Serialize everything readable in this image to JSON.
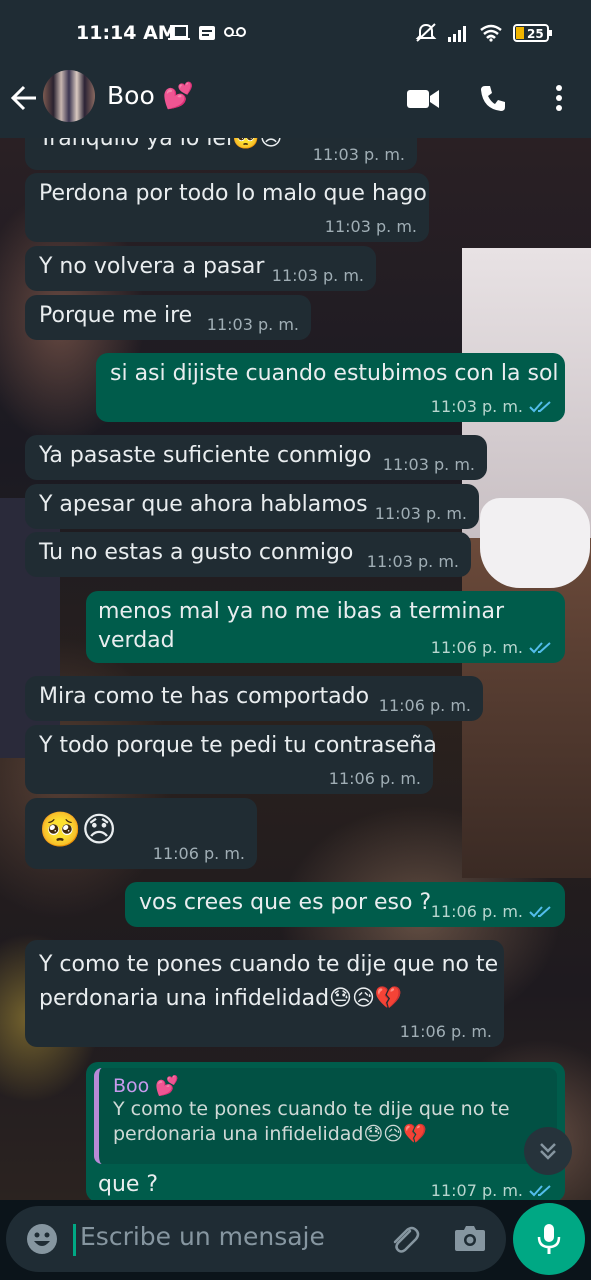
{
  "status_bar": {
    "time": "11:14 AM",
    "battery": "25"
  },
  "header": {
    "contact_name": "Boo 💕"
  },
  "messages": [
    {
      "text": "Tranquilo ya lo leí🥺😞",
      "time": "11:03 p. m."
    },
    {
      "text": "Perdona por todo lo malo que hago",
      "time": "11:03 p. m."
    },
    {
      "text": "Y no volvera a pasar",
      "time": "11:03 p. m."
    },
    {
      "text": "Porque me ire",
      "time": "11:03 p. m."
    },
    {
      "text": "si asi dijiste cuando estubimos con la sol",
      "time": "11:03 p. m."
    },
    {
      "text": "Ya pasaste suficiente conmigo",
      "time": "11:03 p. m."
    },
    {
      "text": "Y apesar que ahora hablamos",
      "time": "11:03 p. m."
    },
    {
      "text": "Tu no estas a gusto conmigo",
      "time": "11:03 p. m."
    },
    {
      "text_line1": "menos mal ya no me ibas a terminar",
      "text_line2": "verdad",
      "time": "11:06 p. m."
    },
    {
      "text": "Mira como te has comportado",
      "time": "11:06 p. m."
    },
    {
      "text": "Y todo porque te pedi tu contraseña",
      "time": "11:06 p. m."
    },
    {
      "text": "🥺😞",
      "time": "11:06 p. m."
    },
    {
      "text": "vos crees que es por eso ?",
      "time": "11:06 p. m."
    },
    {
      "text_line1": "Y como te pones cuando te dije que no te",
      "text_line2": "perdonaria una infidelidad😓😥💔",
      "time": "11:06 p. m."
    },
    {
      "quote_author": "Boo 💕",
      "quote_line1": "Y como te pones cuando te dije que no te",
      "quote_line2": "perdonaria una infidelidad😓😥💔",
      "text": "que ?",
      "time": "11:07 p. m."
    }
  ],
  "composer": {
    "placeholder": "Escribe un mensaje"
  },
  "colors": {
    "incoming": "#202c33",
    "outgoing": "#005c4b",
    "accent": "#00a884",
    "read_ticks": "#53bdeb"
  }
}
